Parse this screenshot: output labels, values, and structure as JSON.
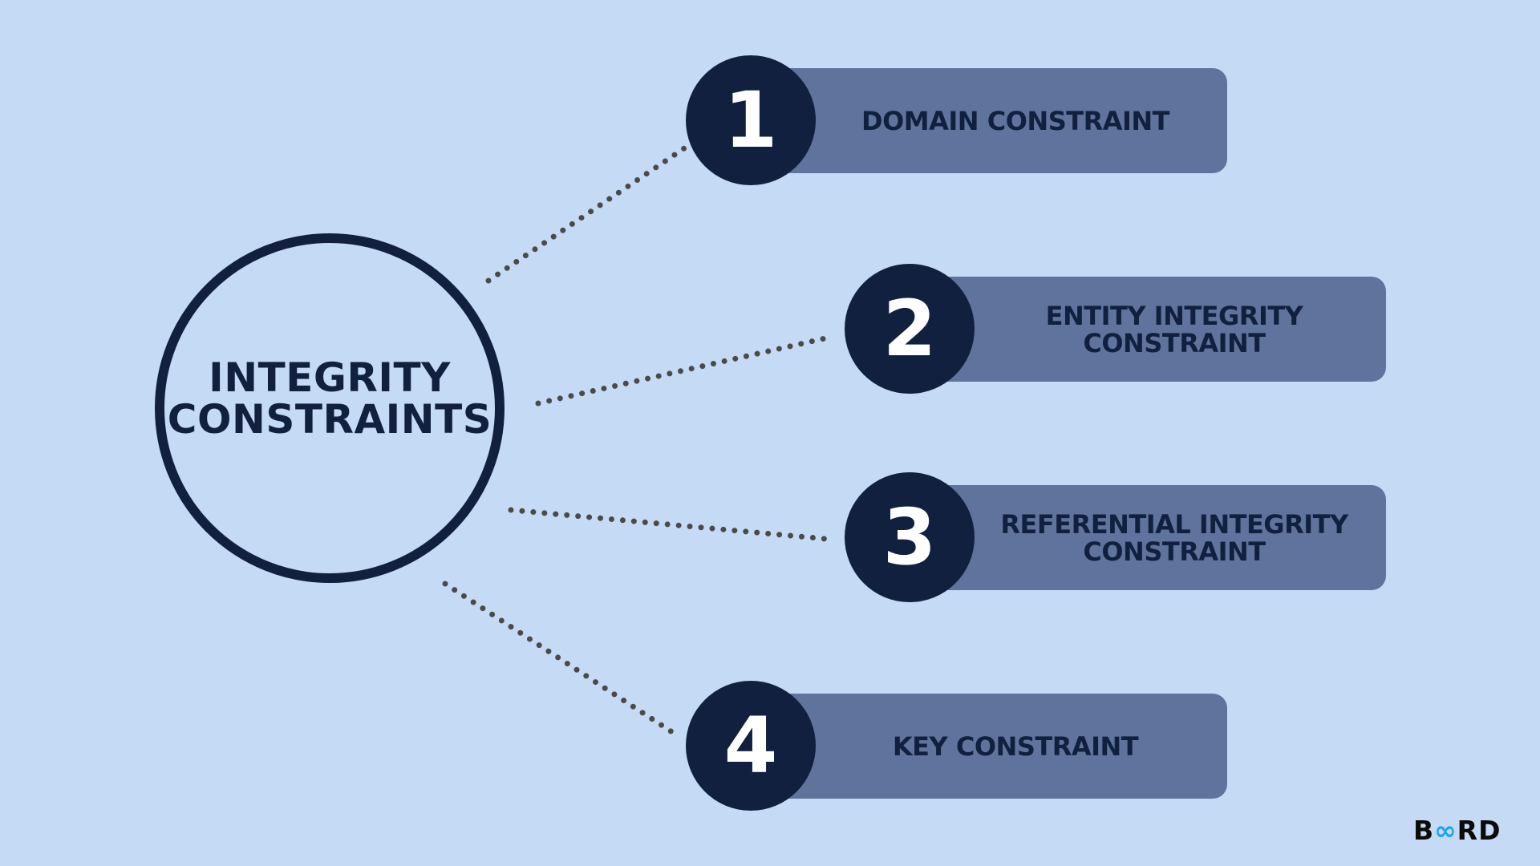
{
  "hub": {
    "title_line1": "INTEGRITY",
    "title_line2": "CONSTRAINTS"
  },
  "items": [
    {
      "number": "1",
      "label_line1": "DOMAIN CONSTRAINT",
      "label_line2": ""
    },
    {
      "number": "2",
      "label_line1": "ENTITY INTEGRITY",
      "label_line2": "CONSTRAINT"
    },
    {
      "number": "3",
      "label_line1": "REFERENTIAL INTEGRITY",
      "label_line2": "CONSTRAINT"
    },
    {
      "number": "4",
      "label_line1": "KEY CONSTRAINT",
      "label_line2": ""
    }
  ],
  "logo": {
    "prefix": "B",
    "infinity": "∞",
    "suffix": "RD"
  },
  "colors": {
    "background": "#c5dbf5",
    "navy": "#11203f",
    "box": "#60739c",
    "dots": "#4a4a4a",
    "logo_accent": "#1fa5e6"
  }
}
